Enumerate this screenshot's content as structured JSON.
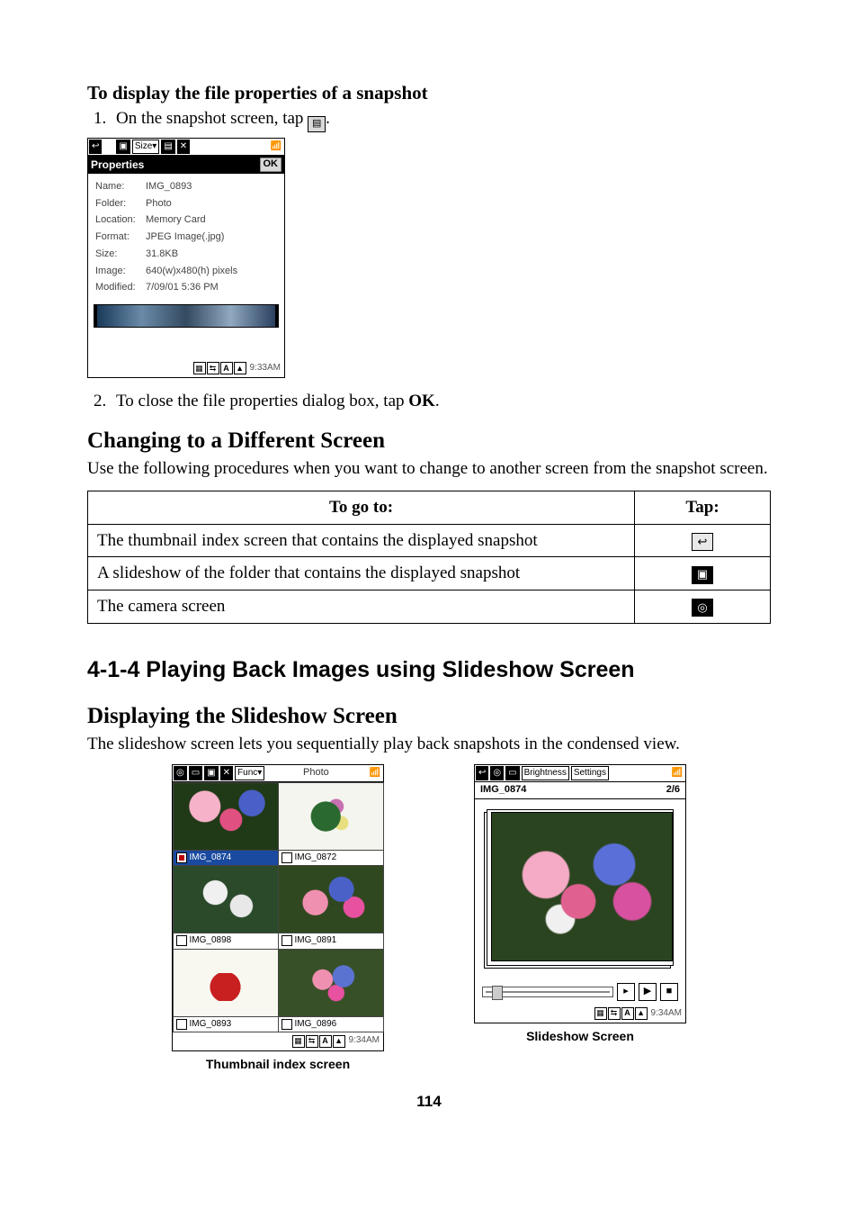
{
  "page_number": "114",
  "h_props": "To display the file properties of a snapshot",
  "step1_a": "On the snapshot screen, tap ",
  "step1_b": ".",
  "step2_a": "To close the file properties dialog box, tap ",
  "step2_b": "OK",
  "step2_c": ".",
  "dev1": {
    "size_label": "Size",
    "title": "Properties",
    "ok": "OK",
    "rows": [
      {
        "k": "Name:",
        "v": "IMG_0893"
      },
      {
        "k": "Folder:",
        "v": "Photo"
      },
      {
        "k": "Location:",
        "v": "Memory Card"
      },
      {
        "k": "Format:",
        "v": "JPEG Image(.jpg)"
      },
      {
        "k": "Size:",
        "v": "31.8KB"
      },
      {
        "k": "Image:",
        "v": "640(w)x480(h) pixels"
      },
      {
        "k": "Modified:",
        "v": "7/09/01 5:36 PM"
      }
    ],
    "time": "9:33AM"
  },
  "h_change": "Changing to a Different Screen",
  "p_change": "Use the following procedures when you want to change to another screen from the snapshot screen.",
  "tab": {
    "h1": "To go to:",
    "h2": "Tap:",
    "r": [
      "The thumbnail index screen that contains the displayed snapshot",
      "A slideshow of the folder that contains the displayed snapshot",
      "The camera screen"
    ]
  },
  "h_414": "4-1-4 Playing Back Images using Slideshow Screen",
  "h_disp": "Displaying the Slideshow Screen",
  "p_disp": "The slideshow screen lets you sequentially play back snapshots in the condensed view.",
  "thumb": {
    "func": "Func",
    "folder": "Photo",
    "names": [
      "IMG_0874",
      "IMG_0872",
      "IMG_0898",
      "IMG_0891",
      "IMG_0893",
      "IMG_0896"
    ],
    "time": "9:34AM",
    "caption": "Thumbnail index screen"
  },
  "slide": {
    "brightness": "Brightness",
    "settings": "Settings",
    "name": "IMG_0874",
    "counter": "2/6",
    "time": "9:34AM",
    "caption": "Slideshow Screen"
  }
}
